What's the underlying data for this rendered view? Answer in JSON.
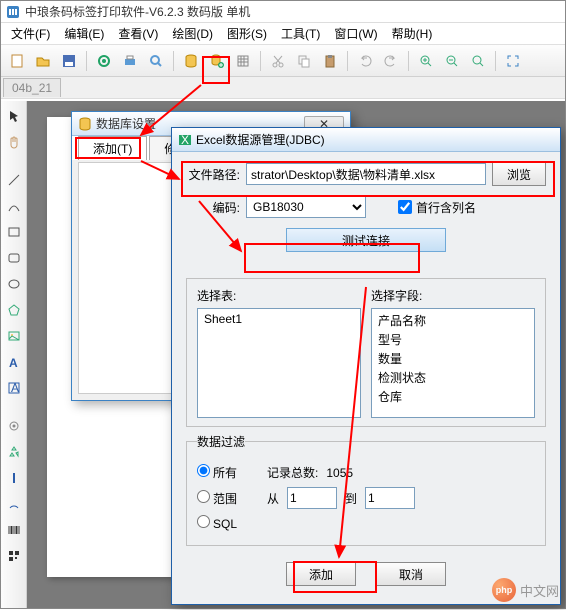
{
  "app": {
    "title": "中琅条码标签打印软件-V6.2.3 数码版 单机",
    "doc_tab": "04b_21"
  },
  "menu": [
    "文件(F)",
    "编辑(E)",
    "查看(V)",
    "绘图(D)",
    "图形(S)",
    "工具(T)",
    "窗口(W)",
    "帮助(H)"
  ],
  "dlg1": {
    "title": "数据库设置",
    "tabs": {
      "add": "添加(T)",
      "modify": "修"
    }
  },
  "dlg2": {
    "title": "Excel数据源管理(JDBC)",
    "path_label": "文件路径:",
    "path_value": "strator\\Desktop\\数据\\物料清单.xlsx",
    "browse": "浏览",
    "encoding_label": "编码:",
    "encoding_value": "GB18030",
    "first_row_header": "首行含列名",
    "test_conn": "测试连接",
    "select_table": "选择表:",
    "select_fields": "选择字段:",
    "tables": [
      "Sheet1"
    ],
    "fields": [
      "产品名称",
      "型号",
      "数量",
      "检测状态",
      "仓库"
    ],
    "filter": {
      "legend": "数据过滤",
      "all": "所有",
      "range": "范围",
      "sql": "SQL",
      "total_label": "记录总数:",
      "total_value": "1055",
      "from": "从",
      "from_v": "1",
      "to": "到",
      "to_v": "1"
    },
    "add": "添加",
    "cancel": "取消"
  },
  "watermark": {
    "logo": "php",
    "text": "中文网"
  }
}
